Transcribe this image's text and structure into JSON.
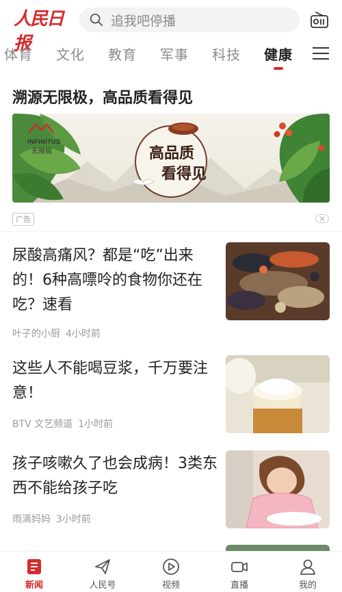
{
  "header": {
    "logo_text": "人民日报",
    "search_placeholder": "追我吧停播"
  },
  "tabs": [
    {
      "label": "体育",
      "active": false
    },
    {
      "label": "文化",
      "active": false
    },
    {
      "label": "教育",
      "active": false
    },
    {
      "label": "军事",
      "active": false
    },
    {
      "label": "科技",
      "active": false
    },
    {
      "label": "健康",
      "active": true
    }
  ],
  "ad": {
    "title": "溯源无限极，高品质看得见",
    "brand_en": "INFINITUS",
    "brand_cn": "无限极",
    "slogan_line1": "高品质",
    "slogan_line2": "看得见",
    "tag": "广告"
  },
  "news": [
    {
      "title": "尿酸高痛风？都是“吃”出来的！6种高嘌呤的食物你还在吃？速看",
      "source": "叶子的小厨",
      "time": "4小时前"
    },
    {
      "title": "这些人不能喝豆浆，千万要注意！",
      "source": "BTV 文艺频道",
      "time": "1小时前"
    },
    {
      "title": "孩子咳嗽久了也会成病！3类东西不能给孩子吃",
      "source": "雨滴妈妈",
      "time": "3小时前"
    }
  ],
  "bottom_nav": [
    {
      "label": "新闻",
      "icon": "news-icon",
      "active": true
    },
    {
      "label": "人民号",
      "icon": "paper-plane-icon",
      "active": false
    },
    {
      "label": "视频",
      "icon": "play-icon",
      "active": false
    },
    {
      "label": "直播",
      "icon": "video-camera-icon",
      "active": false
    },
    {
      "label": "我的",
      "icon": "user-icon",
      "active": false
    }
  ],
  "colors": {
    "brand": "#d42b2b",
    "muted": "#999999"
  }
}
